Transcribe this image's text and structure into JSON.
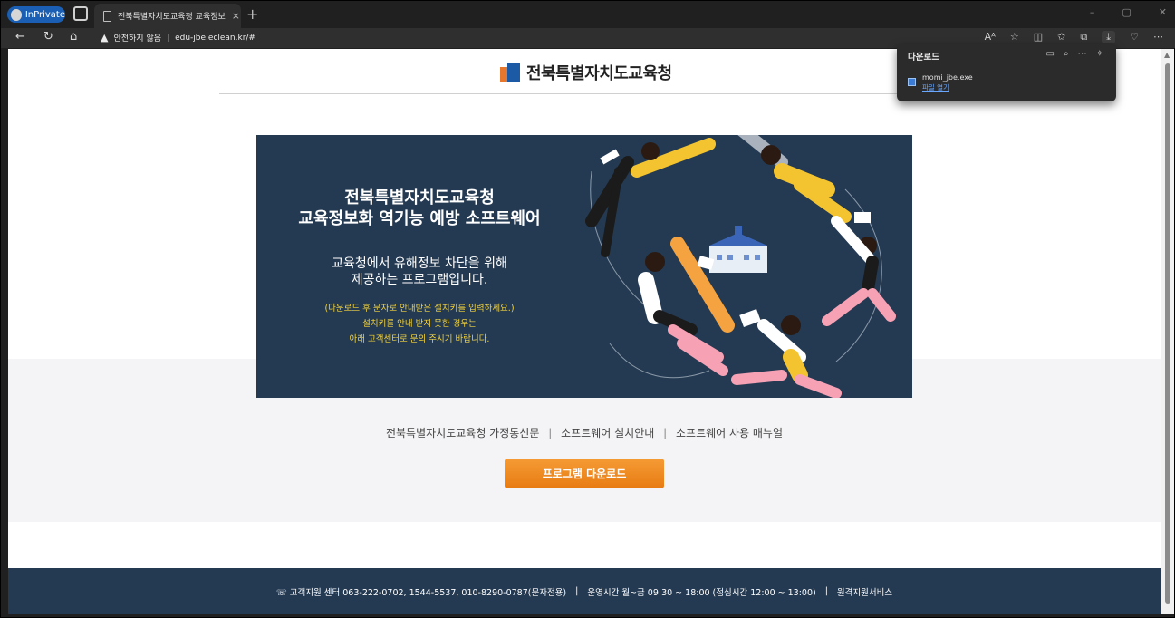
{
  "browser": {
    "inprivate_label": "InPrivate",
    "tab_title": "전북특별자치도교육청 교육정보",
    "tab_close": "×",
    "new_tab": "+",
    "window_controls": [
      "–",
      "▢",
      "✕"
    ],
    "security_text": "안전하지 않음",
    "url": "edu-jbe.eclean.kr/#",
    "toolbar_icons": [
      "read-aloud-icon",
      "favorite-icon",
      "split-screen-icon",
      "favorites-icon",
      "collections-icon",
      "download-icon",
      "copilot-icon",
      "more-icon"
    ]
  },
  "downloads": {
    "title": "다운로드",
    "file_name": "momi_jbe.exe",
    "open_label": "파일 열기"
  },
  "page": {
    "logo_text": "전북특별자치도교육청",
    "banner": {
      "title_line1": "전북특별자치도교육청",
      "title_line2": "교육정보화 역기능 예방 소프트웨어",
      "desc_line1": "교육청에서 유해정보 차단을 위해",
      "desc_line2": "제공하는 프로그램입니다.",
      "note_line1": "(다운로드 후 문자로 안내받은 설치키를 입력하세요.)",
      "note_line2": "설치키를 안내 받지 못한 경우는",
      "note_line3": "아래 고객센터로 문의 주시기 바랍니다."
    },
    "links": [
      "전북특별자치도교육청 가정통신문",
      "소프트웨어 설치안내",
      "소프트웨어 사용 매뉴얼"
    ],
    "link_separator": "|",
    "download_button": "프로그램 다운로드",
    "footer": {
      "support": "☏ 고객지원 센터 063-222-0702, 1544-5537, 010-8290-0787(문자전용)",
      "hours": "운영시간 월~금 09:30 ~ 18:00 (점심시간 12:00 ~ 13:00)",
      "remote": "원격지원서비스",
      "separator": "|"
    }
  },
  "colors": {
    "banner_bg": "#243a52",
    "note_yellow": "#f5d33a",
    "button_orange": "#f08a20"
  }
}
